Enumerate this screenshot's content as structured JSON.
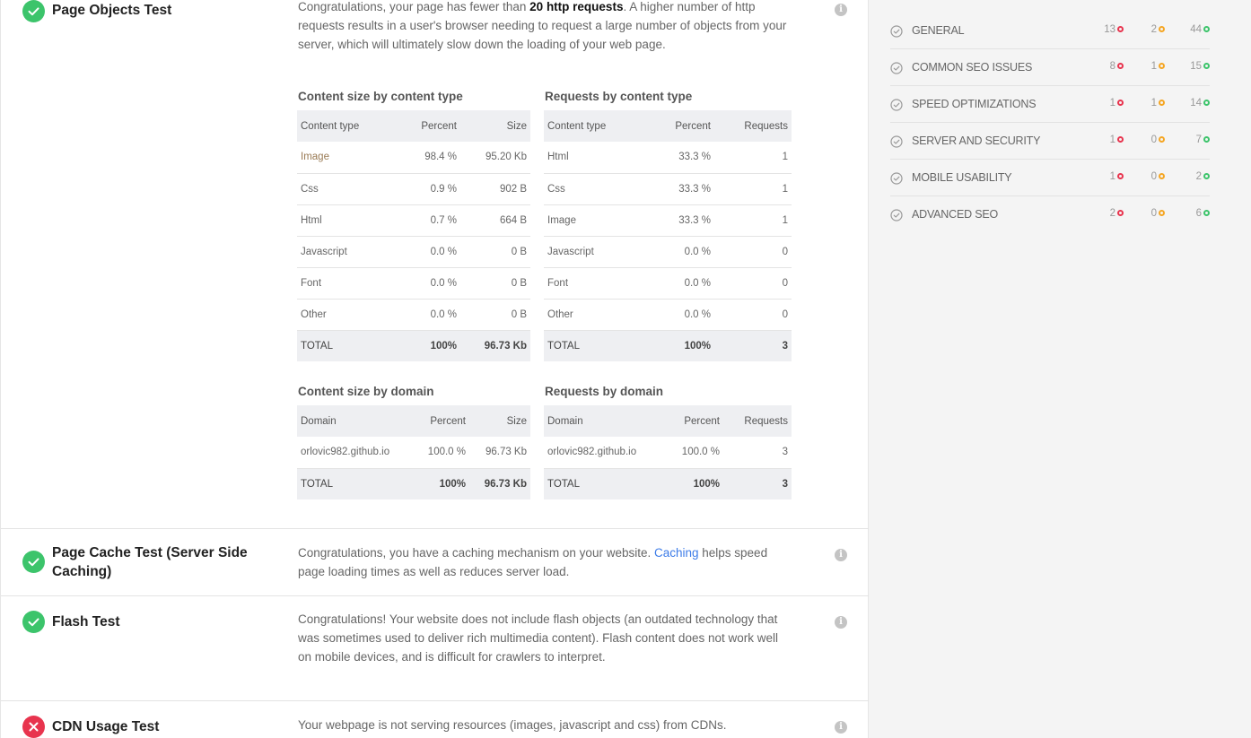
{
  "tests": {
    "page_objects": {
      "title": "Page Objects Test",
      "status": "pass",
      "desc_pre": "Congratulations, your page has fewer than ",
      "desc_bold": "20 http requests",
      "desc_post": ". A higher number of http requests results in a user's browser needing to request a large number of objects from your server, which will ultimately slow down the loading of your web page."
    },
    "page_cache": {
      "title": "Page Cache Test (Server Side Caching)",
      "status": "pass",
      "desc_pre": "Congratulations, you have a caching mechanism on your website. ",
      "desc_link": "Caching",
      "desc_post": " helps speed page loading times as well as reduces server load."
    },
    "flash": {
      "title": "Flash Test",
      "status": "pass",
      "desc": "Congratulations! Your website does not include flash objects (an outdated technology that was sometimes used to deliver rich multimedia content). Flash content does not work well on mobile devices, and is difficult for crawlers to interpret."
    },
    "cdn": {
      "title": "CDN Usage Test",
      "status": "fail",
      "desc": "Your webpage is not serving resources (images, javascript and css) from CDNs."
    }
  },
  "info_glyph": "i",
  "tables": {
    "size_by_type": {
      "title": "Content size by content type",
      "headers": [
        "Content type",
        "Percent",
        "Size"
      ],
      "rows": [
        [
          "Image",
          "98.4 %",
          "95.20 Kb"
        ],
        [
          "Css",
          "0.9 %",
          "902 B"
        ],
        [
          "Html",
          "0.7 %",
          "664 B"
        ],
        [
          "Javascript",
          "0.0 %",
          "0 B"
        ],
        [
          "Font",
          "0.0 %",
          "0 B"
        ],
        [
          "Other",
          "0.0 %",
          "0 B"
        ]
      ],
      "total": [
        "TOTAL",
        "100%",
        "96.73 Kb"
      ]
    },
    "requests_by_type": {
      "title": "Requests by content type",
      "headers": [
        "Content type",
        "Percent",
        "Requests"
      ],
      "rows": [
        [
          "Html",
          "33.3 %",
          "1"
        ],
        [
          "Css",
          "33.3 %",
          "1"
        ],
        [
          "Image",
          "33.3 %",
          "1"
        ],
        [
          "Javascript",
          "0.0 %",
          "0"
        ],
        [
          "Font",
          "0.0 %",
          "0"
        ],
        [
          "Other",
          "0.0 %",
          "0"
        ]
      ],
      "total": [
        "TOTAL",
        "100%",
        "3"
      ]
    },
    "size_by_domain": {
      "title": "Content size by domain",
      "headers": [
        "Domain",
        "Percent",
        "Size"
      ],
      "rows": [
        [
          "orlovic982.github.io",
          "100.0 %",
          "96.73 Kb"
        ]
      ],
      "total": [
        "TOTAL",
        "100%",
        "96.73 Kb"
      ]
    },
    "requests_by_domain": {
      "title": "Requests by domain",
      "headers": [
        "Domain",
        "Percent",
        "Requests"
      ],
      "rows": [
        [
          "orlovic982.github.io",
          "100.0 %",
          "3"
        ]
      ],
      "total": [
        "TOTAL",
        "100%",
        "3"
      ]
    }
  },
  "sidebar": {
    "categories": [
      {
        "label": "GENERAL",
        "failed": "13",
        "warnings": "2",
        "passed": "44"
      },
      {
        "label": "COMMON SEO ISSUES",
        "failed": "8",
        "warnings": "1",
        "passed": "15"
      },
      {
        "label": "SPEED OPTIMIZATIONS",
        "failed": "1",
        "warnings": "1",
        "passed": "14"
      },
      {
        "label": "SERVER AND SECURITY",
        "failed": "1",
        "warnings": "0",
        "passed": "7"
      },
      {
        "label": "MOBILE USABILITY",
        "failed": "1",
        "warnings": "0",
        "passed": "2"
      },
      {
        "label": "ADVANCED SEO",
        "failed": "2",
        "warnings": "0",
        "passed": "6"
      }
    ]
  },
  "colors": {
    "pass": "#3cc46b",
    "fail": "#e8344e",
    "warning": "#f5a623",
    "link": "#3d7ce8"
  }
}
